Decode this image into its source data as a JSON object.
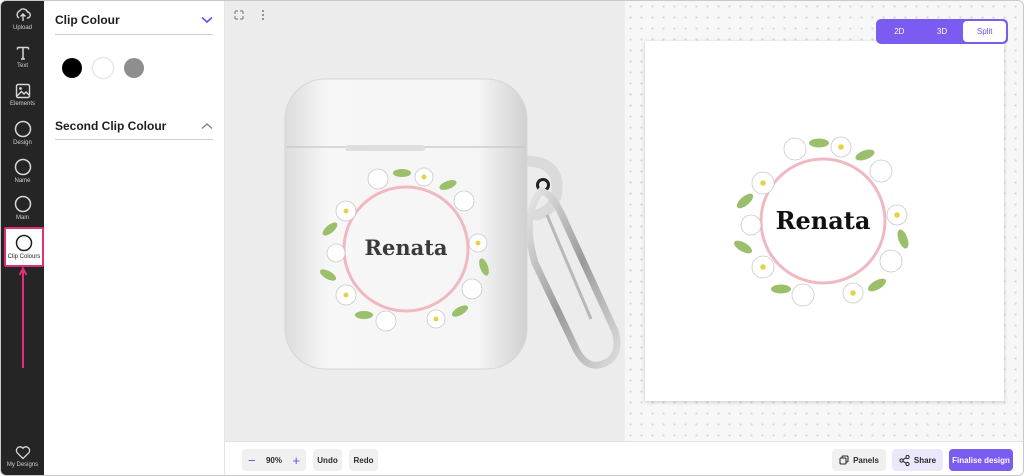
{
  "rail": {
    "items": [
      {
        "label": "Upload",
        "icon": "upload-icon"
      },
      {
        "label": "Text",
        "icon": "text-icon"
      },
      {
        "label": "Elements",
        "icon": "image-icon"
      },
      {
        "label": "Design",
        "icon": "circle-icon"
      },
      {
        "label": "Name",
        "icon": "circle-icon"
      },
      {
        "label": "Main",
        "icon": "circle-icon"
      },
      {
        "label": "Clip Colours",
        "icon": "circle-icon",
        "active": true
      }
    ],
    "footer": {
      "label": "My Designs",
      "icon": "heart-icon"
    },
    "highlight_color": "#e0307a"
  },
  "panel": {
    "clip_colour": {
      "title": "Clip Colour",
      "expanded": true,
      "swatches": [
        {
          "name": "black",
          "color": "#000000"
        },
        {
          "name": "white",
          "color": "#ffffff"
        },
        {
          "name": "grey",
          "color": "#8e8e8e"
        }
      ]
    },
    "second_clip_colour": {
      "title": "Second Clip Colour",
      "expanded": false
    }
  },
  "canvas": {
    "name_text": "Renata",
    "view_modes": [
      "2D",
      "3D",
      "Split"
    ],
    "active_mode": "Split"
  },
  "toolbar": {
    "zoom": "90%",
    "undo": "Undo",
    "redo": "Redo",
    "panels": "Panels",
    "share": "Share",
    "finalise": "Finalise design"
  },
  "colors": {
    "accent": "#7b5cf0",
    "rail": "#252525"
  }
}
